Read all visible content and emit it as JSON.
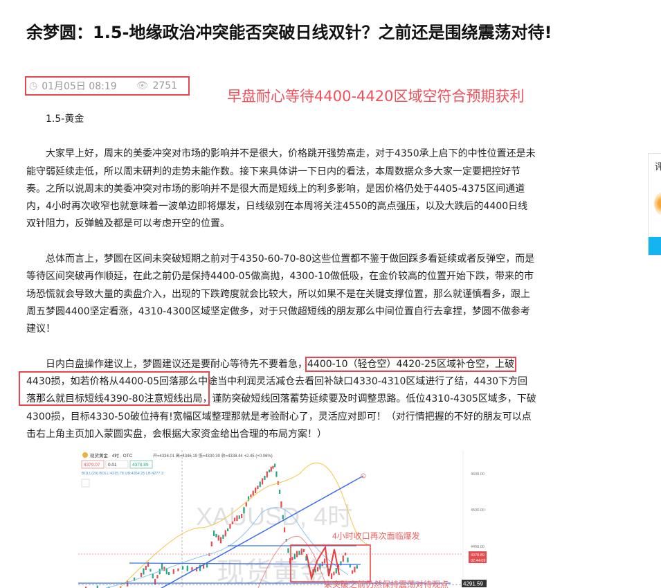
{
  "article": {
    "title": "余梦圆：1.5-地缘政治冲突能否突破日线双针？之前还是围绕震荡对待!",
    "date": "01月05日 08:19",
    "views": "2751",
    "annotation": "早盘耐心等待4400-4420区域空符合预期获利",
    "subtitle": "1.5-黄金",
    "paragraphs": [
      "大家早上好，周末的美委冲突对市场的影响并不是很大，价格跳开强势高走，对于4350承上启下的中性位置还是未能守弱延续走低，所以周末研判的走势未能作数。接下来具体讲一下日内的看法，本周数据众多大家一定要把控好节奏。之所以说周末的美委冲突对市场的影响并不是很大而是短线上的利多影响，是因价格仍处于4405-4375区间通道内，4小时再次收窄也就意味着一波单边即将爆发，日线级别在本周将关注4550的高点强压，以及大跌后的4400日线双针阻力，反弹触及都是可以考虑开空的位置。",
      "总体而言上，梦圆在区间未突破短期之前对于4350-60-70-80这些位置都不鉴于做回踩多看延续或者反弹空，而是等待区间突破再作顺延，在此之前仍是保持4400-05做高抛，4300-10做低吸，在金价较高的位置开始下跌，带来的市场恐慌就会导致大量的卖盘介入，出现的下跌跨度就会比较大，所以如果不是在关键支撑位置，那么就谨慎看多，跟上周五梦圆4400坚定看涨，4310-4300区域坚定做多，对于只做超短线的朋友那么中间位置自行去拿捏，梦圆不做参考建议！"
    ],
    "para3": {
      "lead": "日内白盘操作建议上，梦圆建议还是要耐心等待先不要着急，",
      "highlight": "4400-10（轻仓空）4420-25区域补仓空，上破",
      "rest": "4430损，如若价格从4400-05回落那么中途当中利润灵活减仓去看回补缺口4330-4310区域进行了结，4430下方回落那么就目标短线4390-80注意短线出局，谨防突破短线回落蓄势延续要及时调整思路。低位4310-4305区域多，下破4300损，目标4330-50破位持有!宽幅区域整理那就是考验耐心了，灵活应对即可！（对行情把握的不好的朋友可以点击右上角主页加入蒙圆实盘，会根据大家资金给出合理的布局方案！）"
    },
    "icons": {
      "clock": "clock-icon",
      "views": "eye-icon"
    }
  },
  "side_widget": {
    "label": "评"
  },
  "chart_image": {
    "symbol": "现货黄金 · 4时 · OTC",
    "ohlc": "开=4336.01 高=4346.19 低=4330.30 收=4338.44 +2.45 (+0.06%)",
    "sell": "4379.07",
    "qty": "0.01",
    "buy": "4378.89",
    "boll": "BOLL(20) BOLL:4315.78 UB:4354.25 LB:4277.3",
    "price_ticks": [
      "4600.00",
      "4500.00",
      "4400.00"
    ],
    "current_price": "4378.89",
    "countdown": "02:44:09",
    "crosshair_price": "4291.59",
    "watermark_1": "XAUUSD, 4时",
    "watermark_2": "现货黄金",
    "annotation_top": "4小时收口再次面临爆发",
    "annotation_bottom": "未突破之前仍然保持震荡对待观点",
    "colors": {
      "up": "#e84b4b",
      "down": "#20a885",
      "trend": "#3b6ef0",
      "mark": "#ee3b3b"
    }
  }
}
